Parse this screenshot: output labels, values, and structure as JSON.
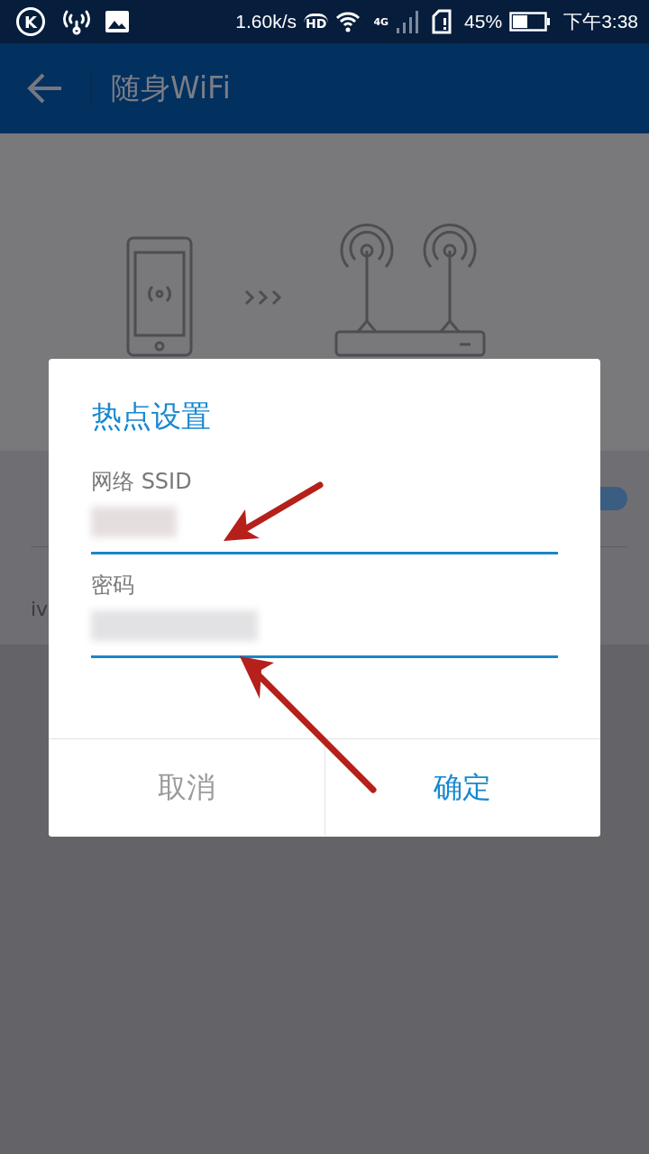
{
  "status_bar": {
    "app_badge": "K",
    "speed": "1.60k/s",
    "hd_label": "HD",
    "network_label": "4G",
    "battery": "45%",
    "time": "下午3:38"
  },
  "app_bar": {
    "title": "随身WiFi"
  },
  "background": {
    "row_2_subtitle": "iv",
    "toggle_on": true
  },
  "dialog": {
    "title": "热点设置",
    "fields": [
      {
        "label": "网络 SSID",
        "kind": "blurred"
      },
      {
        "label": "密码",
        "kind": "blurred"
      }
    ],
    "buttons": [
      {
        "label": "取消",
        "primary": false
      },
      {
        "label": "确定",
        "primary": true
      }
    ]
  }
}
